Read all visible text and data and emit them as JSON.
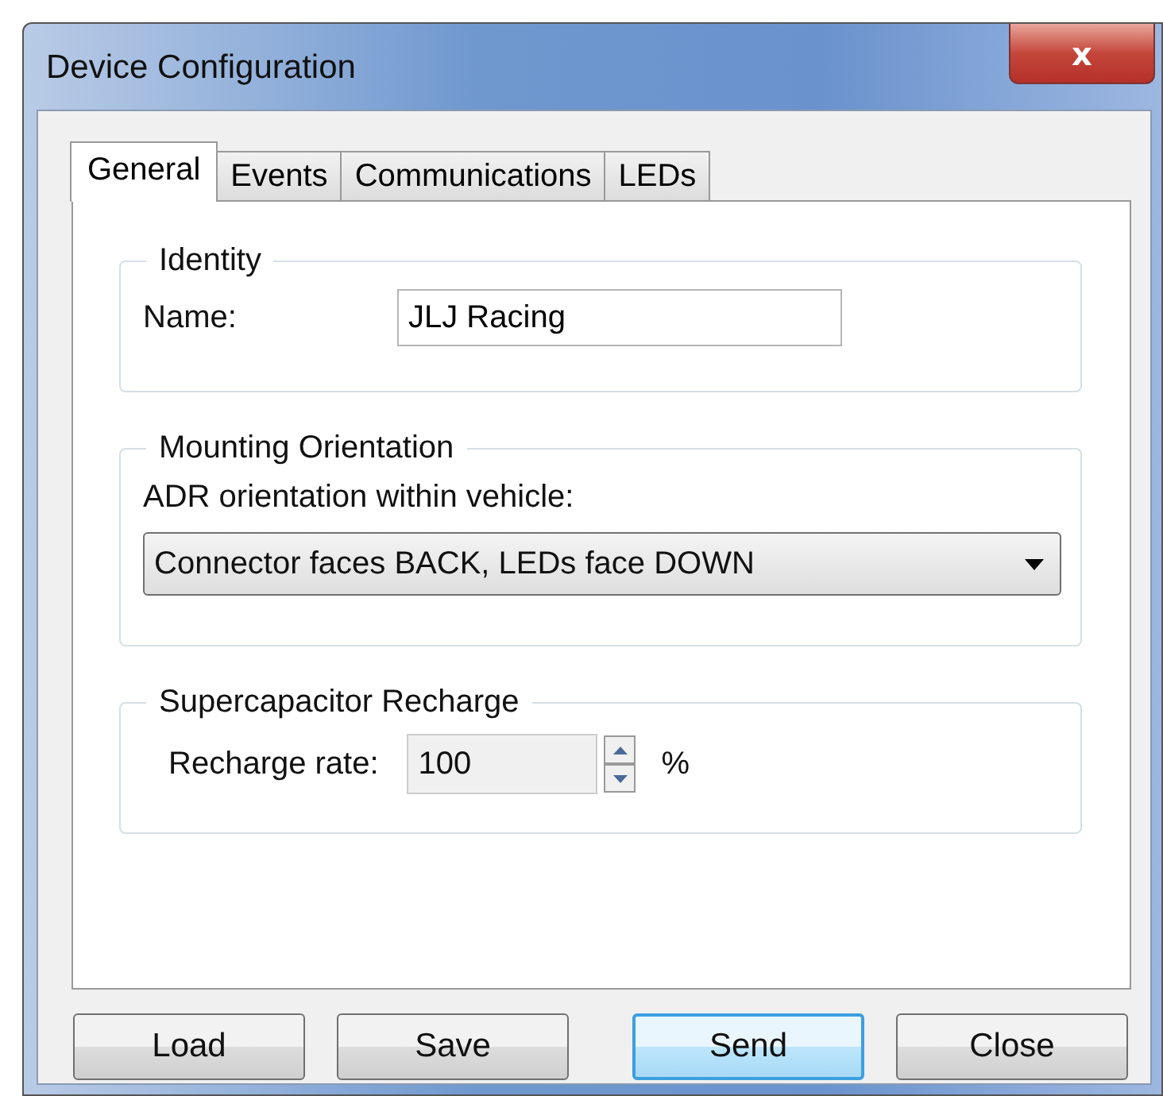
{
  "window": {
    "title": "Device Configuration",
    "close": "x"
  },
  "tabs": [
    {
      "label": "General",
      "selected": true
    },
    {
      "label": "Events",
      "selected": false
    },
    {
      "label": "Communications",
      "selected": false
    },
    {
      "label": "LEDs",
      "selected": false
    }
  ],
  "identity": {
    "title": "Identity",
    "name_label": "Name:",
    "name_value": "JLJ Racing"
  },
  "mounting": {
    "title": "Mounting Orientation",
    "prompt": "ADR orientation within vehicle:",
    "selection": "Connector faces BACK, LEDs face DOWN"
  },
  "supercapacitor": {
    "title": "Supercapacitor Recharge",
    "rate_label": "Recharge rate:",
    "rate_value": "100",
    "unit": "%"
  },
  "buttons": [
    {
      "label": "Load",
      "default": false
    },
    {
      "label": "Save",
      "default": false
    },
    {
      "label": "Send",
      "default": true
    },
    {
      "label": "Close",
      "default": false
    }
  ]
}
